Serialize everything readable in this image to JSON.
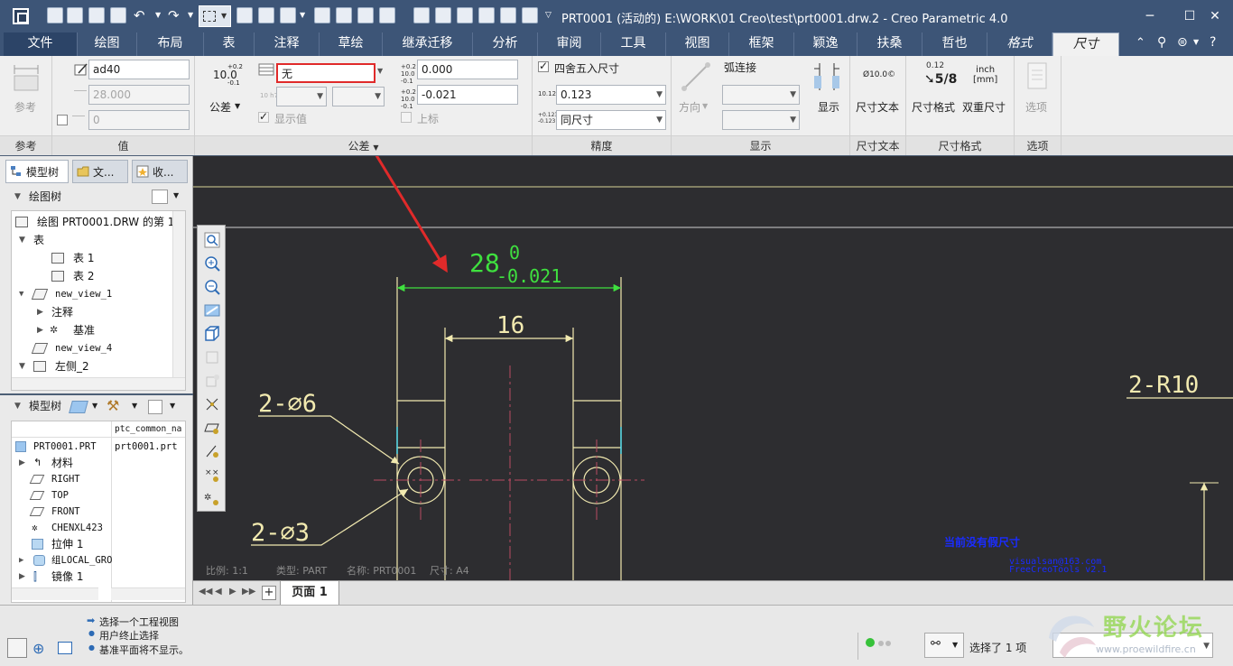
{
  "window": {
    "title": "PRT0001 (活动的) E:\\WORK\\01 Creo\\test\\prt0001.drw.2 - Creo Parametric 4.0"
  },
  "tabs": [
    {
      "label": "文件"
    },
    {
      "label": "绘图"
    },
    {
      "label": "布局"
    },
    {
      "label": "表"
    },
    {
      "label": "注释"
    },
    {
      "label": "草绘"
    },
    {
      "label": "继承迁移"
    },
    {
      "label": "分析"
    },
    {
      "label": "审阅"
    },
    {
      "label": "工具"
    },
    {
      "label": "视图"
    },
    {
      "label": "框架"
    },
    {
      "label": "颖逸"
    },
    {
      "label": "扶桑"
    },
    {
      "label": "哲也"
    },
    {
      "label": "格式"
    },
    {
      "label": "尺寸"
    }
  ],
  "ribbon": {
    "reference": {
      "button": "参考",
      "group": "参考"
    },
    "value": {
      "name": "ad40",
      "nominal": "28.000",
      "override": "0",
      "group": "值"
    },
    "tolerance": {
      "format_btn": "公差",
      "sample_top": "10.0",
      "sample_sup": "+0.2",
      "sample_sub": "-0.1",
      "mode": "无",
      "upper": "0.000",
      "lower": "-0.021",
      "show_value": "显示值",
      "upper_label": "上标",
      "group": "公差"
    },
    "precision": {
      "round": "四舍五入尺寸",
      "decimals": "0.123",
      "tol_decimals": "同尺寸",
      "group": "精度"
    },
    "display": {
      "direction": "方向",
      "arc": "弧连接",
      "show": "显示",
      "group": "显示"
    },
    "dim_text": {
      "button": "尺寸文本",
      "group": "尺寸文本",
      "icon_text": "Ø10.0©"
    },
    "dim_format": {
      "format": "尺寸格式",
      "dual": "双重尺寸",
      "group": "尺寸格式",
      "frac_top": "0.12",
      "frac": "5/8",
      "unit_top": "inch",
      "unit_bottom": "[mm]"
    },
    "options": {
      "button": "选项",
      "group": "选项"
    }
  },
  "left_tabs": [
    {
      "label": "模型树"
    },
    {
      "label": "文..."
    },
    {
      "label": "收..."
    }
  ],
  "drawing_tree": {
    "header": "绘图树",
    "items": [
      {
        "label": "绘图 PRT0001.DRW 的第 1 页"
      },
      {
        "label": "表"
      },
      {
        "label": "表 1"
      },
      {
        "label": "表 2"
      },
      {
        "label": "new_view_1"
      },
      {
        "label": "注释"
      },
      {
        "label": "基准"
      },
      {
        "label": "new_view_4"
      },
      {
        "label": "左侧_2"
      }
    ]
  },
  "model_tree": {
    "header": "模型树",
    "col2": "ptc_common_na",
    "items": [
      {
        "label": "PRT0001.PRT",
        "value": "prt0001.prt"
      },
      {
        "label": "材料"
      },
      {
        "label": "RIGHT"
      },
      {
        "label": "TOP"
      },
      {
        "label": "FRONT"
      },
      {
        "label": "CHENXL423"
      },
      {
        "label": "拉伸 1"
      },
      {
        "label": "组LOCAL_GRO"
      },
      {
        "label": "镜像 1"
      }
    ]
  },
  "drawing": {
    "dim_main": "28",
    "dim_upper": "0",
    "dim_lower": "-0.021",
    "dim_inner": "16",
    "hole_big": "2-∅6",
    "hole_small": "2-∅3",
    "radius": "2-R10",
    "no_fake": "当前没有假尺寸",
    "credit1": "visualsan@163.com",
    "credit2": "FreeCreoTools v2.1",
    "scale": "比例: 1:1",
    "type": "类型: PART",
    "name": "名称: PRT0001",
    "size": "尺寸: A4"
  },
  "sheet": {
    "tab": "页面 1"
  },
  "status": {
    "messages": [
      "选择一个工程视图",
      "用户终止选择",
      "基准平面将不显示。"
    ],
    "selected": "选择了 1 项"
  },
  "watermark": {
    "text": "野火论坛",
    "url": "www.proewildfire.cn"
  },
  "colors": {
    "titlebar": "#3d5577",
    "canvas": "#2d2d30",
    "dim_green": "#3fe03f",
    "dim_yellow": "#f2eab0",
    "highlight_red": "#e02a2a",
    "text_blue": "#1a2cff"
  }
}
